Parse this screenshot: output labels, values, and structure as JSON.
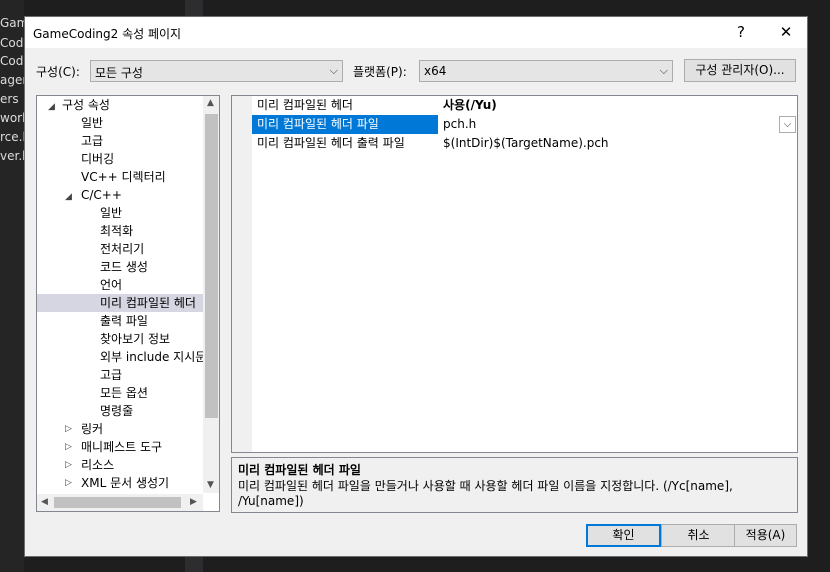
{
  "background": {
    "items": [
      "Game",
      "Cod",
      "Cod",
      "ager",
      "ers",
      "work",
      "rce.h",
      "ver.h"
    ]
  },
  "dialog": {
    "title": "GameCoding2 속성 페이지",
    "help": "?",
    "close": "✕"
  },
  "toolbar": {
    "config_label": "구성(C):",
    "config_value": "모든 구성",
    "platform_label": "플랫폼(P):",
    "platform_value": "x64",
    "config_manager": "구성 관리자(O)..."
  },
  "tree": {
    "root": "구성 속성",
    "general": "일반",
    "advanced": "고급",
    "debugging": "디버깅",
    "vcpp_dirs": "VC++ 디렉터리",
    "cpp": "C/C++",
    "cpp_general": "일반",
    "cpp_optimization": "최적화",
    "cpp_preprocessor": "전처리기",
    "cpp_codegen": "코드 생성",
    "cpp_language": "언어",
    "cpp_pch": "미리 컴파일된 헤더",
    "cpp_output": "출력 파일",
    "cpp_browse": "찾아보기 정보",
    "cpp_external": "외부 include 지시문",
    "cpp_advanced": "고급",
    "cpp_all": "모든 옵션",
    "cpp_cmdline": "명령줄",
    "linker": "링커",
    "manifest": "매니페스트 도구",
    "resources": "리소스",
    "xmldoc": "XML 문서 생성기"
  },
  "grid": {
    "rows": [
      {
        "name": "미리 컴파일된 헤더",
        "value": "사용(/Yu)"
      },
      {
        "name": "미리 컴파일된 헤더 파일",
        "value": "pch.h"
      },
      {
        "name": "미리 컴파일된 헤더 출력 파일",
        "value": "$(IntDir)$(TargetName).pch"
      }
    ]
  },
  "description": {
    "title": "미리 컴파일된 헤더 파일",
    "text": "미리 컴파일된 헤더 파일을 만들거나 사용할 때 사용할 헤더 파일 이름을 지정합니다. (/Yc[name], /Yu[name])"
  },
  "buttons": {
    "ok": "확인",
    "cancel": "취소",
    "apply": "적용(A)"
  },
  "icons": {
    "expanded": "◢",
    "collapsed": "▷",
    "chevron": "⌵"
  },
  "colors": {
    "selection": "#0078d7",
    "tree_selection": "#d6d6e2"
  }
}
